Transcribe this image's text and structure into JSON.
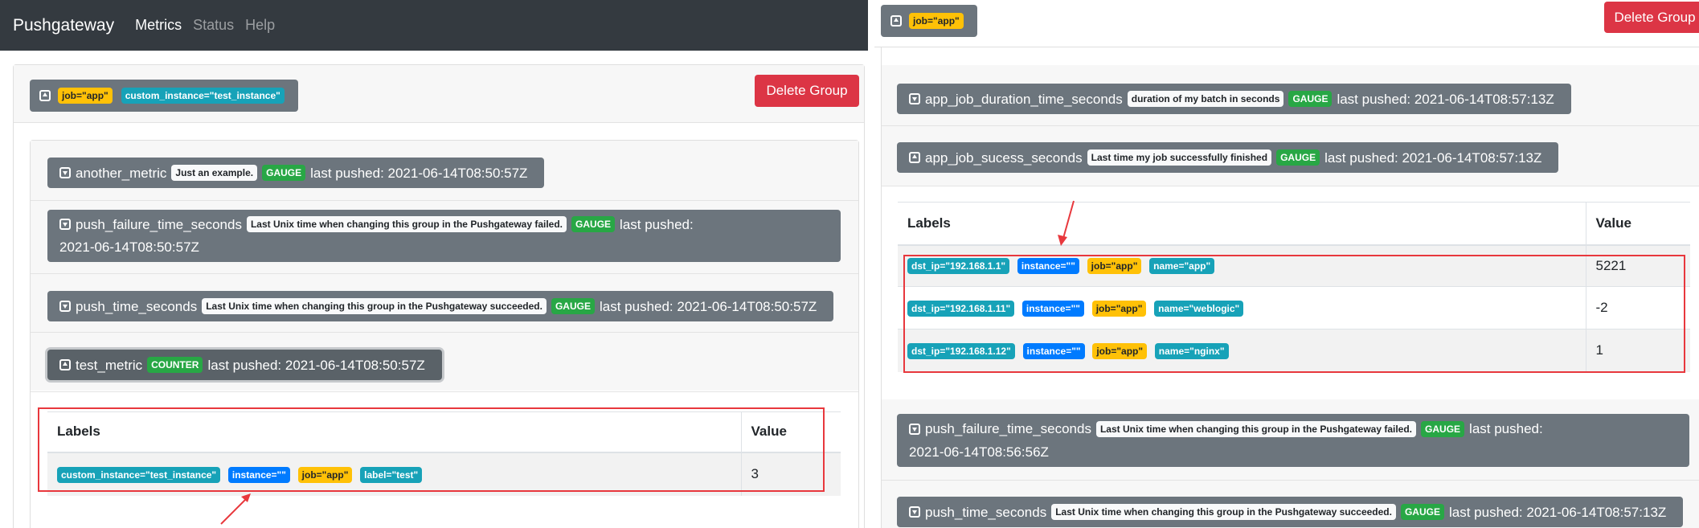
{
  "navbar": {
    "brand": "Pushgateway",
    "items": [
      {
        "label": "Metrics",
        "active": true
      },
      {
        "label": "Status",
        "active": false
      },
      {
        "label": "Help",
        "active": false
      }
    ]
  },
  "left": {
    "group_labels": [
      "job=\"app\"",
      "custom_instance=\"test_instance\""
    ],
    "delete_label": "Delete Group",
    "metrics": [
      {
        "name": "another_metric",
        "help": "Just an example.",
        "type": "GAUGE",
        "pushed": "last pushed: 2021-06-14T08:50:57Z"
      },
      {
        "name": "push_failure_time_seconds",
        "help": "Last Unix time when changing this group in the Pushgateway failed.",
        "type": "GAUGE",
        "pushed_a": "last pushed:",
        "pushed_b": "2021-06-14T08:50:57Z"
      },
      {
        "name": "push_time_seconds",
        "help": "Last Unix time when changing this group in the Pushgateway succeeded.",
        "type": "GAUGE",
        "pushed": "last pushed: 2021-06-14T08:50:57Z"
      },
      {
        "name": "test_metric",
        "type": "COUNTER",
        "pushed": "last pushed: 2021-06-14T08:50:57Z"
      }
    ],
    "table": {
      "headers": [
        "Labels",
        "Value"
      ],
      "row": {
        "labels": [
          "custom_instance=\"test_instance\"",
          "instance=\"\"",
          "job=\"app\"",
          "label=\"test\""
        ],
        "value": "3"
      }
    }
  },
  "right": {
    "group_labels": [
      "job=\"app\""
    ],
    "delete_label": "Delete Group",
    "metrics": [
      {
        "name": "app_job_duration_time_seconds",
        "help": "duration of my batch in seconds",
        "type": "GAUGE",
        "pushed": "last pushed: 2021-06-14T08:57:13Z"
      },
      {
        "name": "app_job_sucess_seconds",
        "help": "Last time my job successfully finished",
        "type": "GAUGE",
        "pushed": "last pushed: 2021-06-14T08:57:13Z"
      },
      {
        "name": "push_failure_time_seconds",
        "help": "Last Unix time when changing this group in the Pushgateway failed.",
        "type": "GAUGE",
        "pushed_a": "last pushed:",
        "pushed_b": "2021-06-14T08:56:56Z"
      },
      {
        "name": "push_time_seconds",
        "help": "Last Unix time when changing this group in the Pushgateway succeeded.",
        "type": "GAUGE",
        "pushed": "last pushed: 2021-06-14T08:57:13Z"
      }
    ],
    "table": {
      "headers": [
        "Labels",
        "Value"
      ],
      "rows": [
        {
          "labels": [
            "dst_ip=\"192.168.1.1\"",
            "instance=\"\"",
            "job=\"app\"",
            "name=\"app\""
          ],
          "value": "5221"
        },
        {
          "labels": [
            "dst_ip=\"192.168.1.11\"",
            "instance=\"\"",
            "job=\"app\"",
            "name=\"weblogic\""
          ],
          "value": "-2"
        },
        {
          "labels": [
            "dst_ip=\"192.168.1.12\"",
            "instance=\"\"",
            "job=\"app\"",
            "name=\"nginx\""
          ],
          "value": "1"
        }
      ]
    }
  },
  "colors": {
    "navbar": "#343a40",
    "metric_button": "#6c757d",
    "delete": "#dc3545",
    "annotation": "#e8383d"
  }
}
